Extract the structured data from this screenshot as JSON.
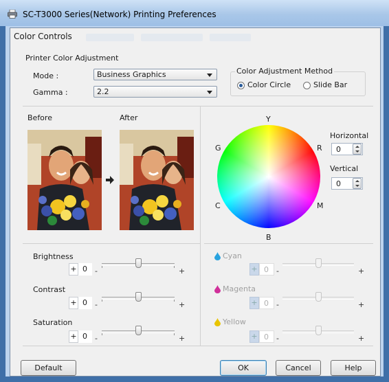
{
  "window": {
    "title": "SC-T3000 Series(Network) Printing Preferences"
  },
  "dialog": {
    "title": "Color Controls",
    "printer_color_adjustment": {
      "heading": "Printer Color Adjustment",
      "mode": {
        "label": "Mode :",
        "value": "Business Graphics"
      },
      "gamma": {
        "label": "Gamma :",
        "value": "2.2"
      }
    },
    "color_adjustment_method": {
      "heading": "Color Adjustment Method",
      "options": [
        {
          "label": "Color Circle",
          "selected": true
        },
        {
          "label": "Slide Bar",
          "selected": false
        }
      ]
    },
    "preview": {
      "before_label": "Before",
      "after_label": "After"
    },
    "color_circle": {
      "labels": {
        "top": "Y",
        "top_left": "G",
        "top_right": "R",
        "bottom_left": "C",
        "bottom_right": "M",
        "bottom": "B"
      },
      "horizontal": {
        "label": "Horizontal",
        "value": "0"
      },
      "vertical": {
        "label": "Vertical",
        "value": "0"
      }
    },
    "adjustments": [
      {
        "label": "Brightness",
        "sign": "+",
        "value": "0",
        "minus": "-",
        "plus": "+",
        "level": 0.5
      },
      {
        "label": "Contrast",
        "sign": "+",
        "value": "0",
        "minus": "-",
        "plus": "+",
        "level": 0.5
      },
      {
        "label": "Saturation",
        "sign": "+",
        "value": "0",
        "minus": "-",
        "plus": "+",
        "level": 0.5
      }
    ],
    "color_adjustments": [
      {
        "label": "Cyan",
        "sign": "+",
        "value": "0",
        "minus": "-",
        "plus": "+",
        "level": 0.5,
        "color": "#29a3df"
      },
      {
        "label": "Magenta",
        "sign": "+",
        "value": "0",
        "minus": "-",
        "plus": "+",
        "level": 0.5,
        "color": "#d0309a"
      },
      {
        "label": "Yellow",
        "sign": "+",
        "value": "0",
        "minus": "-",
        "plus": "+",
        "level": 0.5,
        "color": "#e8c400"
      }
    ],
    "buttons": {
      "default": "Default",
      "ok": "OK",
      "cancel": "Cancel",
      "help": "Help"
    }
  },
  "colors": {
    "title_bar": "#a9c7e8",
    "frame": "#bcd3ee",
    "dialog_bg": "#f0f0f0",
    "selection": "#2a5c9a"
  },
  "icons": [
    "printer-icon",
    "arrow-right-icon",
    "chevron-down-icon",
    "droplet-icon"
  ]
}
